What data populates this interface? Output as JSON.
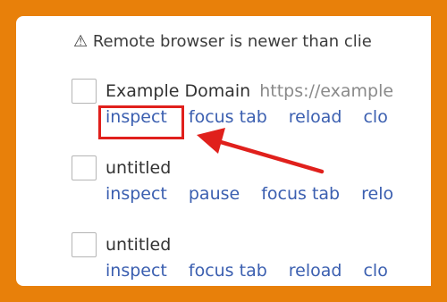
{
  "colors": {
    "frame": "#E8800A",
    "annotation": "#E0201C",
    "link": "#3b5fb0"
  },
  "warning": {
    "icon": "warning-triangle-icon",
    "text": "⚠ Remote browser is newer than clie"
  },
  "entries": [
    {
      "title": "Example Domain",
      "url": "https://example",
      "actions": [
        "inspect",
        "focus tab",
        "reload",
        "clo"
      ]
    },
    {
      "title": "untitled",
      "url": "",
      "actions": [
        "inspect",
        "pause",
        "focus tab",
        "relo"
      ]
    },
    {
      "title": "untitled",
      "url": "",
      "actions": [
        "inspect",
        "focus tab",
        "reload",
        "clo"
      ]
    }
  ]
}
